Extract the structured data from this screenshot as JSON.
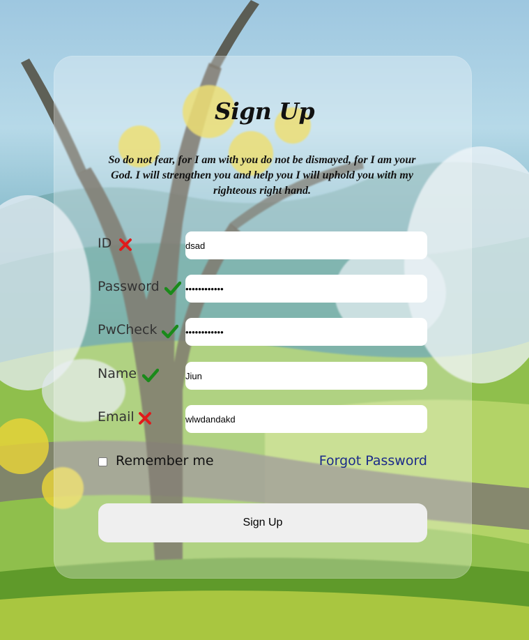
{
  "page": {
    "title": "Sign Up",
    "verse": "So do not fear, for I am with you do not be dismayed, for I am your God. I will strengthen you and help you I will uphold you with my righteous right hand."
  },
  "colors": {
    "valid": "#1a8a1a",
    "invalid": "#e01b1b",
    "link": "#1b2a8a",
    "button_bg": "#efefef",
    "card_bg": "rgba(255,255,255,0.30)"
  },
  "background": {
    "icon": "painted-landscape-with-trees"
  },
  "form": {
    "fields": [
      {
        "label": "ID",
        "value": "dsad",
        "type": "text",
        "status": "invalid",
        "status_icon": "x-mark-icon"
      },
      {
        "label": "Password",
        "value": "••••••••••••",
        "type": "password",
        "status": "valid",
        "status_icon": "check-mark-icon"
      },
      {
        "label": "PwCheck",
        "value": "••••••••••••",
        "type": "password",
        "status": "valid",
        "status_icon": "check-mark-icon"
      },
      {
        "label": "Name",
        "value": "Jiun",
        "type": "text",
        "status": "valid",
        "status_icon": "check-mark-icon"
      },
      {
        "label": "Email",
        "value": "wlwdandakd",
        "type": "text",
        "status": "invalid",
        "status_icon": "x-mark-icon"
      }
    ],
    "remember_label": "Remember me",
    "remember_checked": false,
    "forgot_label": "Forgot Password",
    "submit_label": "Sign Up"
  }
}
